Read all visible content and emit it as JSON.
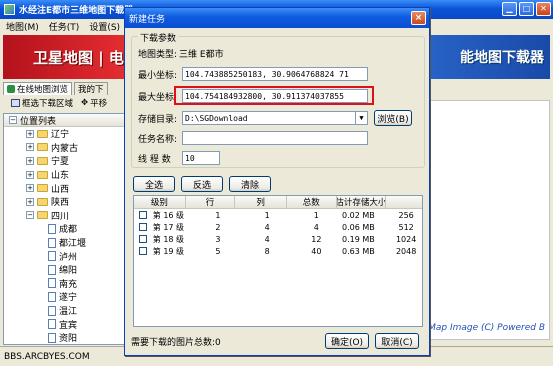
{
  "main": {
    "title": "水经注E都市三维地图下载器",
    "menu": [
      "地图(M)",
      "任务(T)",
      "设置(S)"
    ],
    "banner_left": "卫星地图 | 电子",
    "banner_right": "能地图下载器",
    "tabs": [
      "在线地图浏览",
      "我的下"
    ],
    "toolbar": [
      "框选下载区域",
      "平移"
    ],
    "left_header": "位置列表",
    "provinces": [
      "辽宁",
      "内蒙古",
      "宁夏",
      "山东",
      "山西",
      "陕西",
      "四川"
    ],
    "cities": [
      "成都",
      "都江堰",
      "泸州",
      "绵阳",
      "南充",
      "遂宁",
      "温江",
      "宜宾",
      "资阳"
    ],
    "map_caption": "Map Image (C) Powered B",
    "status_text": "BBS.ARCBYES.COM"
  },
  "dialog": {
    "title": "新建任务",
    "close_symbol": "×",
    "group_title": "下载参数",
    "map_type_label": "地图类型:",
    "map_type_value": "三维 E都市",
    "min_coord_label": "最小坐标:",
    "min_coord_value": "104.743885250183, 30.9064768824 71",
    "max_coord_label": "最大坐标:",
    "max_coord_value": "104.754184932800, 30.911374037855",
    "dir_label": "存储目录:",
    "dir_value": "D:\\SGDownload",
    "browse_label": "浏览(B)",
    "task_name_label": "任务名称:",
    "task_name_value": "",
    "threads_label": "线 程 数",
    "threads_value": "10",
    "select_all": "全选",
    "invert": "反选",
    "clear": "清除",
    "columns": [
      "级别",
      "行",
      "列",
      "总数",
      "估计存储大小",
      ""
    ],
    "rows": [
      {
        "level": "第 16 级",
        "row": "1",
        "col": "1",
        "total": "1",
        "size": "0.02 MB",
        "extra": "256"
      },
      {
        "level": "第 17 级",
        "row": "2",
        "col": "4",
        "total": "4",
        "size": "0.06 MB",
        "extra": "512"
      },
      {
        "level": "第 18 级",
        "row": "3",
        "col": "4",
        "total": "12",
        "size": "0.19 MB",
        "extra": "1024"
      },
      {
        "level": "第 19 级",
        "row": "5",
        "col": "8",
        "total": "40",
        "size": "0.63 MB",
        "extra": "2048"
      }
    ],
    "footer_text": "需要下载的图片总数:0",
    "ok": "确定(O)",
    "cancel": "取消(C)"
  }
}
